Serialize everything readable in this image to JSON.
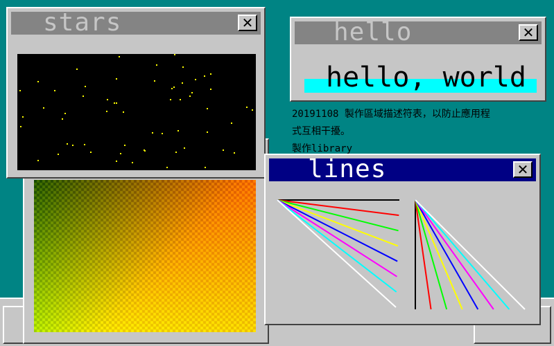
{
  "colors": {
    "desktop": "#008484",
    "window_face": "#c6c6c6",
    "title_inactive": "#848484",
    "title_active": "#000084",
    "star": "#ffff00",
    "hello_highlight": "#00ffff"
  },
  "windows": {
    "stars": {
      "title": "stars",
      "close_icon": "close-icon"
    },
    "hello": {
      "title": "hello",
      "message": "hello, world",
      "close_icon": "close-icon"
    },
    "lines": {
      "title": "lines",
      "close_icon": "close-icon"
    }
  },
  "desktop_text": {
    "line1": "20191108 製作區域描述符表，以防止應用程",
    "line2": "式互相干擾。",
    "line3": "製作library"
  },
  "close_label": "✕",
  "line_colors": [
    "#000000",
    "#ff0000",
    "#00ff00",
    "#ffff00",
    "#0000ff",
    "#ff00ff",
    "#00ffff",
    "#ffffff"
  ]
}
